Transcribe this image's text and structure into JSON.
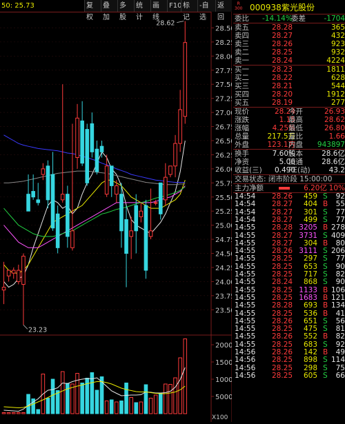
{
  "toolbar": {
    "left_readout": "50: 25.73",
    "buttons": [
      "复权",
      "叠加",
      "多股",
      "统计",
      "画线",
      "F10",
      "标记",
      "-自选",
      "返回"
    ]
  },
  "stock": {
    "badge_top": "R",
    "badge_bottom": "300",
    "code": "000938",
    "name": "紫光股份"
  },
  "order_stats": [
    {
      "label": "委比",
      "value": "-14.14%",
      "label2": "委差",
      "value2": "-1704"
    }
  ],
  "sell_orders": [
    {
      "label": "卖五",
      "price": "28.28",
      "vol": "365"
    },
    {
      "label": "卖四",
      "price": "28.27",
      "vol": "432"
    },
    {
      "label": "卖三",
      "price": "28.26",
      "vol": "923"
    },
    {
      "label": "卖二",
      "price": "28.25",
      "vol": "932"
    },
    {
      "label": "卖一",
      "price": "28.24",
      "vol": "4224"
    }
  ],
  "buy_orders": [
    {
      "label": "买一",
      "price": "28.23",
      "vol": "1811"
    },
    {
      "label": "买二",
      "price": "28.22",
      "vol": "628"
    },
    {
      "label": "买三",
      "price": "28.21",
      "vol": "544"
    },
    {
      "label": "买四",
      "price": "28.20",
      "vol": "1912"
    },
    {
      "label": "买五",
      "price": "28.19",
      "vol": "277"
    }
  ],
  "quote": [
    {
      "l1": "现价",
      "v1": "28.24",
      "l2": "今开",
      "v2": "26.93"
    },
    {
      "l1": "涨跌",
      "v1": "1.15",
      "l2": "最高",
      "v2": "28.62"
    },
    {
      "l1": "涨幅",
      "v1": "4.25%",
      "l2": "最低",
      "v2": "26.80"
    },
    {
      "l1": "总量",
      "v1": "217.5万",
      "l2": "量比",
      "v2": "1.66"
    },
    {
      "l1": "外盘",
      "v1": "123.1万",
      "l2": "内盘",
      "v2": "943897"
    }
  ],
  "fundamentals": [
    {
      "l1": "换手",
      "v1": "7.60%",
      "l2": "股本",
      "v2": "28.6亿"
    },
    {
      "l1": "净资",
      "v1": "5.06",
      "l2": "流通",
      "v2": "28.6亿"
    },
    {
      "l1": "收益(三)",
      "v1": "0.490",
      "l2": "PE(动)",
      "v2": "43.2"
    }
  ],
  "trade_status": "交易状态: 闭市阶段 15:00:00",
  "main_flow": {
    "label": "主力净额",
    "value": "6.20亿",
    "pct": "10%"
  },
  "ticks": [
    {
      "time": "14:54",
      "price": "28.26",
      "vol": "459",
      "side": "S",
      "extra": "92"
    },
    {
      "time": "14:54",
      "price": "28.27",
      "vol": "404",
      "side": "B",
      "extra": "55"
    },
    {
      "time": "14:54",
      "price": "28.27",
      "vol": "301",
      "side": "S",
      "extra": "77"
    },
    {
      "time": "14:54",
      "price": "28.27",
      "vol": "499",
      "side": "S",
      "extra": "77"
    },
    {
      "time": "14:55",
      "price": "28.28",
      "vol": "3205",
      "side": "B",
      "extra": "278"
    },
    {
      "time": "14:55",
      "price": "28.27",
      "vol": "3731",
      "side": "S",
      "extra": "409"
    },
    {
      "time": "14:55",
      "price": "28.27",
      "vol": "304",
      "side": "B",
      "extra": "80"
    },
    {
      "time": "14:55",
      "price": "28.26",
      "vol": "3111",
      "side": "S",
      "extra": "206"
    },
    {
      "time": "14:55",
      "price": "28.25",
      "vol": "297",
      "side": "S",
      "extra": "77"
    },
    {
      "time": "14:55",
      "price": "28.25",
      "vol": "653",
      "side": "S",
      "extra": "90"
    },
    {
      "time": "14:55",
      "price": "28.25",
      "vol": "717",
      "side": "S",
      "extra": "82"
    },
    {
      "time": "14:55",
      "price": "28.24",
      "vol": "868",
      "side": "S",
      "extra": "90"
    },
    {
      "time": "14:55",
      "price": "28.25",
      "vol": "1133",
      "side": "B",
      "extra": "106"
    },
    {
      "time": "14:55",
      "price": "28.25",
      "vol": "1683",
      "side": "B",
      "extra": "121"
    },
    {
      "time": "14:55",
      "price": "28.28",
      "vol": "693",
      "side": "B",
      "extra": "134"
    },
    {
      "time": "14:55",
      "price": "28.25",
      "vol": "536",
      "side": "B",
      "extra": "41"
    },
    {
      "time": "14:55",
      "price": "28.26",
      "vol": "651",
      "side": "S",
      "extra": "56"
    },
    {
      "time": "14:55",
      "price": "28.25",
      "vol": "475",
      "side": "S",
      "extra": "81"
    },
    {
      "time": "14:55",
      "price": "28.26",
      "vol": "552",
      "side": "B",
      "extra": "82"
    },
    {
      "time": "14:55",
      "price": "28.25",
      "vol": "683",
      "side": "S",
      "extra": "92"
    },
    {
      "time": "14:56",
      "price": "28.26",
      "vol": "142",
      "side": "B",
      "extra": "49"
    },
    {
      "time": "14:56",
      "price": "28.25",
      "vol": "898",
      "side": "S",
      "extra": "114"
    },
    {
      "time": "14:56",
      "price": "28.25",
      "vol": "298",
      "side": "S",
      "extra": "75"
    },
    {
      "time": "14:56",
      "price": "28.25",
      "vol": "605",
      "side": "S",
      "extra": "66"
    }
  ],
  "colors": {
    "up": "#ff3b3b",
    "down": "#36d6e0",
    "bg": "#000000",
    "label": "#c8c8c8",
    "price_hi": "#e8e800",
    "ma5": "#e6e6e6",
    "ma10": "#e8e800",
    "ma20": "#ff55ff",
    "ma30": "#23d143",
    "ma60": "#3a3aff"
  },
  "chart_data": {
    "type": "candlestick",
    "price_ylim": [
      23.1,
      28.75
    ],
    "price_ticks": [
      "28.50",
      "28.25",
      "28.00",
      "27.75",
      "27.50",
      "27.25",
      "27.00",
      "26.75",
      "26.50",
      "26.25",
      "26.00",
      "25.75",
      "25.50",
      "25.25",
      "25.00",
      "24.75",
      "24.50",
      "24.25",
      "24.00",
      "23.75",
      "23.50"
    ],
    "annotations": [
      {
        "text": "28.62",
        "value": 28.62
      },
      {
        "text": "23.23",
        "value": 23.23
      }
    ],
    "candles": [
      {
        "o": 23.85,
        "c": 23.9,
        "h": 24.35,
        "l": 23.6
      },
      {
        "o": 24.1,
        "c": 24.2,
        "h": 24.2,
        "l": 24.0
      },
      {
        "o": 24.15,
        "c": 24.2,
        "h": 24.25,
        "l": 24.05
      },
      {
        "o": 24.0,
        "c": 24.2,
        "h": 24.3,
        "l": 23.95
      },
      {
        "o": 23.95,
        "c": 24.45,
        "h": 24.5,
        "l": 23.23
      },
      {
        "o": 25.55,
        "c": 25.25,
        "h": 25.9,
        "l": 25.25
      },
      {
        "o": 25.6,
        "c": 25.5,
        "h": 25.9,
        "l": 25.45
      },
      {
        "o": 25.45,
        "c": 25.4,
        "h": 25.75,
        "l": 25.35
      },
      {
        "o": 25.9,
        "c": 26.0,
        "h": 26.1,
        "l": 25.8
      },
      {
        "o": 26.05,
        "c": 25.45,
        "h": 26.15,
        "l": 25.3
      },
      {
        "o": 25.9,
        "c": 24.95,
        "h": 26.3,
        "l": 24.9
      },
      {
        "o": 25.2,
        "c": 24.6,
        "h": 25.35,
        "l": 24.5
      },
      {
        "o": 25.45,
        "c": 25.55,
        "h": 27.5,
        "l": 25.4
      },
      {
        "o": 25.55,
        "c": 24.8,
        "h": 25.7,
        "l": 24.6
      },
      {
        "o": 24.6,
        "c": 24.9,
        "h": 26.8,
        "l": 24.55
      },
      {
        "o": 26.2,
        "c": 26.9,
        "h": 27.15,
        "l": 26.0
      },
      {
        "o": 26.85,
        "c": 26.1,
        "h": 27.2,
        "l": 26.05
      },
      {
        "o": 26.7,
        "c": 25.75,
        "h": 26.8,
        "l": 25.7
      },
      {
        "o": 26.8,
        "c": 26.3,
        "h": 27.0,
        "l": 26.2
      },
      {
        "o": 26.35,
        "c": 25.95,
        "h": 26.5,
        "l": 25.9
      },
      {
        "o": 26.4,
        "c": 26.3,
        "h": 26.5,
        "l": 26.2
      },
      {
        "o": 25.55,
        "c": 26.05,
        "h": 26.25,
        "l": 25.5
      },
      {
        "o": 26.05,
        "c": 25.7,
        "h": 26.05,
        "l": 25.5
      },
      {
        "o": 25.55,
        "c": 25.7,
        "h": 25.8,
        "l": 25.4
      },
      {
        "o": 25.55,
        "c": 24.9,
        "h": 25.75,
        "l": 24.6
      },
      {
        "o": 25.1,
        "c": 24.5,
        "h": 25.35,
        "l": 23.9
      },
      {
        "o": 24.8,
        "c": 24.9,
        "h": 25.15,
        "l": 24.4
      },
      {
        "o": 25.35,
        "c": 24.9,
        "h": 25.55,
        "l": 24.5
      },
      {
        "o": 25.15,
        "c": 25.25,
        "h": 25.4,
        "l": 25.05
      },
      {
        "o": 25.35,
        "c": 24.2,
        "h": 25.45,
        "l": 24.05
      },
      {
        "o": 24.8,
        "c": 24.9,
        "h": 25.65,
        "l": 24.75
      },
      {
        "o": 25.4,
        "c": 25.4,
        "h": 25.45,
        "l": 25.35
      },
      {
        "o": 25.75,
        "c": 25.2,
        "h": 25.75,
        "l": 25.1
      },
      {
        "o": 25.45,
        "c": 25.85,
        "h": 26.1,
        "l": 25.35
      },
      {
        "o": 25.9,
        "c": 26.05,
        "h": 26.05,
        "l": 25.85
      },
      {
        "o": 26.05,
        "c": 26.45,
        "h": 26.6,
        "l": 25.85
      },
      {
        "o": 26.45,
        "c": 27.05,
        "h": 27.4,
        "l": 26.3
      },
      {
        "o": 26.93,
        "c": 28.24,
        "h": 28.62,
        "l": 26.8
      }
    ],
    "ma_series": [
      {
        "key": "ma5",
        "values": [
          24.0,
          23.9,
          23.95,
          24.05,
          24.1,
          24.3,
          24.6,
          24.85,
          25.1,
          25.35,
          25.45,
          25.4,
          25.3,
          25.35,
          25.2,
          25.3,
          25.55,
          25.75,
          25.9,
          26.1,
          26.3,
          26.2,
          26.0,
          25.9,
          25.7,
          25.35,
          25.1,
          25.0,
          24.95,
          24.9,
          24.85,
          24.95,
          25.05,
          25.2,
          25.4,
          25.6,
          25.95,
          26.5
        ]
      },
      {
        "key": "ma10",
        "values": [
          24.3,
          24.2,
          24.15,
          24.15,
          24.2,
          24.3,
          24.45,
          24.6,
          24.75,
          24.9,
          25.05,
          25.1,
          25.15,
          25.2,
          25.25,
          25.3,
          25.35,
          25.45,
          25.55,
          25.65,
          25.75,
          25.8,
          25.8,
          25.75,
          25.7,
          25.6,
          25.5,
          25.45,
          25.4,
          25.35,
          25.3,
          25.3,
          25.3,
          25.35,
          25.4,
          25.45,
          25.55,
          25.8
        ]
      },
      {
        "key": "ma20",
        "values": [
          25.0,
          24.9,
          24.8,
          24.7,
          24.65,
          24.6,
          24.6,
          24.6,
          24.65,
          24.7,
          24.75,
          24.8,
          24.85,
          24.9,
          24.95,
          25.0,
          25.05,
          25.1,
          25.15,
          25.2,
          25.25,
          25.3,
          25.35,
          25.4,
          25.4,
          25.4,
          25.4,
          25.4,
          25.4,
          25.4,
          25.4,
          25.42,
          25.45,
          25.48,
          25.5,
          25.55,
          25.6,
          25.7
        ]
      },
      {
        "key": "ma30",
        "values": [
          25.3,
          25.2,
          25.1,
          25.0,
          24.95,
          24.9,
          24.85,
          24.82,
          24.8,
          24.8,
          24.8,
          24.82,
          24.85,
          24.88,
          24.9,
          24.95,
          25.0,
          25.05,
          25.1,
          25.15,
          25.2,
          25.22,
          25.25,
          25.28,
          25.3,
          25.32,
          25.35,
          25.38,
          25.4,
          25.42,
          25.45,
          25.48,
          25.5,
          25.52,
          25.55,
          25.58,
          25.62,
          25.68
        ]
      },
      {
        "key": "ma60",
        "values": [
          26.6,
          26.55,
          26.5,
          26.45,
          26.42,
          26.4,
          26.38,
          26.36,
          26.35,
          26.34,
          26.33,
          26.32,
          26.3,
          26.28,
          26.27,
          26.25,
          26.22,
          26.2,
          26.17,
          26.14,
          26.1,
          26.07,
          26.04,
          26.0,
          25.97,
          25.94,
          25.9,
          25.88,
          25.86,
          25.84,
          25.82,
          25.8,
          25.79,
          25.78,
          25.77,
          25.76,
          25.76,
          25.76
        ]
      },
      {
        "key": "ma120",
        "values": [
          25.75,
          25.75,
          25.76,
          25.77,
          25.78,
          25.8,
          25.82,
          25.84,
          25.86,
          25.88,
          25.9,
          25.92,
          25.93,
          25.94,
          25.95,
          25.96,
          25.96,
          25.96,
          25.95,
          25.94,
          25.93,
          25.92,
          25.9,
          25.88,
          25.86,
          25.84,
          25.82,
          25.8,
          25.78,
          25.76,
          25.75,
          25.74,
          25.73,
          25.72,
          25.72,
          25.72,
          25.73,
          25.73
        ]
      }
    ],
    "volume_ylim": [
      0,
      22000
    ],
    "volume_ticks": [
      "20000",
      "15000",
      "10000",
      "5000"
    ],
    "volume_unit": "X100",
    "volumes": [
      300,
      300,
      300,
      300,
      300,
      5600,
      4300,
      1200,
      11500,
      4500,
      10000,
      6700,
      12200,
      8800,
      8600,
      11700,
      8900,
      10300,
      11900,
      6800,
      10700,
      3700,
      4000,
      3400,
      3700,
      8900,
      4700,
      3200,
      3400,
      8400,
      4500,
      5400,
      5900,
      8600,
      8500,
      10400,
      16200,
      21700
    ],
    "volume_ma": [
      {
        "key": "ma5",
        "values": [
          1000,
          900,
          800,
          700,
          1300,
          2400,
          3400,
          4300,
          5700,
          6800,
          7000,
          7500,
          8900,
          8700,
          9300,
          9700,
          10000,
          10200,
          10100,
          10400,
          9200,
          7900,
          6600,
          5900,
          5200,
          5300,
          5400,
          5400,
          5500,
          6300,
          6200,
          6000,
          6000,
          6100,
          6500,
          7700,
          9900,
          13400
        ]
      },
      {
        "key": "ma10",
        "values": [
          2000,
          1900,
          1800,
          1700,
          1800,
          2200,
          2800,
          3400,
          4000,
          4700,
          5400,
          6000,
          6600,
          7200,
          7600,
          8000,
          8300,
          8700,
          9000,
          9300,
          9300,
          9000,
          8600,
          8000,
          7400,
          7000,
          6700,
          6400,
          6300,
          6300,
          6100,
          5900,
          5800,
          5800,
          6000,
          6300,
          6900,
          8000
        ]
      }
    ]
  }
}
